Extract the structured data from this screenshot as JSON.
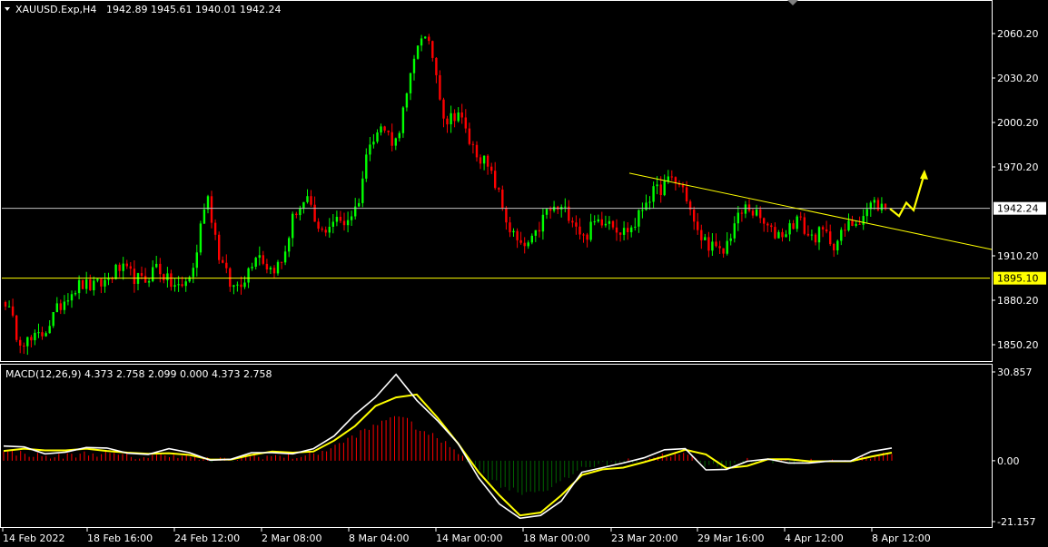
{
  "header": {
    "symbol": "XAUUSD.Exp,H4",
    "ohlc": "1942.89 1945.61 1940.01 1942.24"
  },
  "macd": {
    "label": "MACD(12,26,9) 4.373 2.758 2.099 0.000 4.373 2.758"
  },
  "colors": {
    "bull": "#00ff00",
    "bear": "#ff0000",
    "grid_line": "#c0c0c0",
    "trend": "#ffff00",
    "macd_main": "#ffffff",
    "macd_signal": "#ffff00",
    "hist_pos": "#ff0000",
    "hist_neg": "#006400"
  },
  "chart_data": [
    {
      "type": "candlestick",
      "title": "XAUUSD.Exp,H4",
      "ylim": [
        1840,
        2075
      ],
      "y_ticks": [
        "2060.20",
        "2030.20",
        "2000.20",
        "1970.20",
        "1910.20",
        "1880.20",
        "1850.20"
      ],
      "y_tick_values": [
        2060.2,
        2030.2,
        2000.2,
        1970.2,
        1910.2,
        1880.2,
        1850.2
      ],
      "current_price": {
        "value": 1942.24,
        "label": "1942.24"
      },
      "level_line": {
        "value": 1895.1,
        "label": "1895.10"
      },
      "trendline": {
        "from": {
          "x": "23 Mar 20:00",
          "y": 1966
        },
        "to": {
          "x": "8 Apr 12:00",
          "y": 1916
        }
      },
      "forecast_arrow": {
        "points": [
          1942,
          1937,
          1946,
          1941,
          1966
        ]
      },
      "x_ticks": [
        "14 Feb 2022",
        "18 Feb 16:00",
        "24 Feb 12:00",
        "2 Mar 08:00",
        "8 Mar 04:00",
        "14 Mar 00:00",
        "18 Mar 00:00",
        "23 Mar 20:00",
        "29 Mar 16:00",
        "4 Apr 12:00",
        "8 Apr 12:00"
      ],
      "close_path": [
        1880,
        1855,
        1852,
        1858,
        1872,
        1885,
        1891,
        1889,
        1893,
        1902,
        1897,
        1892,
        1904,
        1892,
        1888,
        1902,
        1955,
        1910,
        1888,
        1895,
        1914,
        1901,
        1905,
        1940,
        1947,
        1924,
        1934,
        1933,
        1944,
        1990,
        1997,
        1986,
        2020,
        2062,
        2045,
        2000,
        2008,
        1985,
        1975,
        1958,
        1930,
        1915,
        1920,
        1940,
        1942,
        1938,
        1922,
        1934,
        1936,
        1926,
        1930,
        1949,
        1955,
        1962,
        1955,
        1925,
        1918,
        1910,
        1932,
        1944,
        1935,
        1925,
        1926,
        1936,
        1922,
        1926,
        1918,
        1930,
        1936,
        1946,
        1942
      ]
    },
    {
      "type": "macd",
      "title": "MACD(12,26,9) 4.373 2.758 2.099 0.000 4.373 2.758",
      "ylim": [
        -21.157,
        30.857
      ],
      "y_ticks": [
        "30.857",
        "0.00",
        "-21.157"
      ],
      "y_tick_values": [
        30.857,
        0,
        -21.157
      ],
      "main": [
        5.1,
        4.8,
        2.4,
        3.0,
        4.6,
        4.4,
        2.6,
        2.2,
        4.2,
        2.8,
        0.2,
        0.5,
        2.8,
        2.8,
        2.4,
        4.2,
        8.6,
        16,
        22,
        30,
        21,
        14,
        6,
        -6,
        -15,
        -20,
        -19,
        -14,
        -4,
        -2.4,
        -0.8,
        1,
        3.8,
        4.2,
        -3.2,
        -3.0,
        -0.2,
        0.6,
        -0.8,
        -0.8,
        -0.1,
        -0.1,
        3.2,
        4.4
      ],
      "signal": [
        3.4,
        4.2,
        3.6,
        3.6,
        4.2,
        3.4,
        2.8,
        2.4,
        2.6,
        2.0,
        0.4,
        0.4,
        2.0,
        3.2,
        2.8,
        3.2,
        7.0,
        12,
        19,
        22,
        23,
        15,
        6,
        -4,
        -12,
        -19,
        -18,
        -12,
        -5,
        -3,
        -2.4,
        -0.5,
        1.5,
        3.8,
        2.2,
        -2.6,
        -1.8,
        0.5,
        0.5,
        -0.2,
        -0.2,
        -0.2,
        1.4,
        2.8
      ]
    }
  ]
}
